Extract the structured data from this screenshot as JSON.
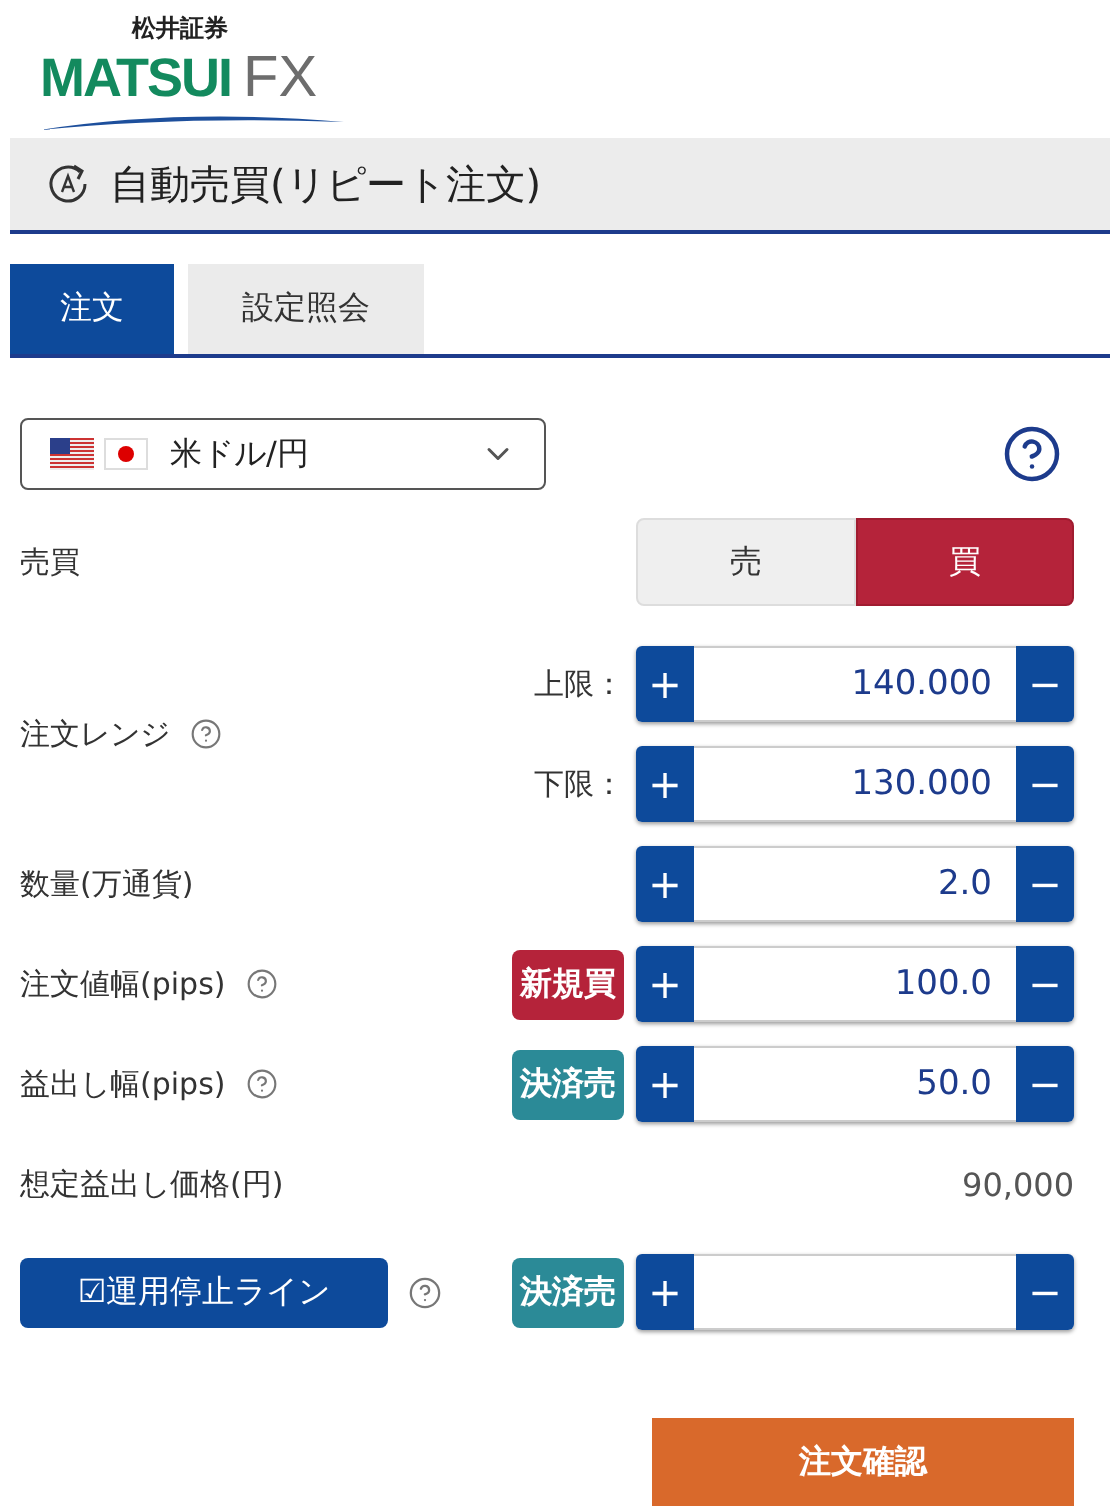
{
  "logo": {
    "caption": "松井証券",
    "brand": "MATSUI",
    "suffix": "FX"
  },
  "title": "自動売買(リピート注文)",
  "tabs": [
    {
      "label": "注文",
      "selected": true
    },
    {
      "label": "設定照会",
      "selected": false
    }
  ],
  "pair_select": {
    "value": "米ドル/円"
  },
  "side": {
    "label": "売買",
    "options": [
      {
        "label": "売",
        "selected": false
      },
      {
        "label": "買",
        "selected": true
      }
    ]
  },
  "range": {
    "label": "注文レンジ",
    "help": true,
    "bounds": [
      {
        "label": "上限：",
        "plus": "+",
        "value": "140.000",
        "minus": "−"
      },
      {
        "label": "下限：",
        "plus": "+",
        "value": "130.000",
        "minus": "−"
      }
    ]
  },
  "rows": [
    {
      "kind": "stepper",
      "label": "数量(万通貨)",
      "help": false,
      "plus": "+",
      "value": "2.0",
      "minus": "−"
    },
    {
      "kind": "stepper",
      "label": "注文値幅(pips)",
      "help": true,
      "tag": {
        "label": "新規買",
        "color": "#b5233a"
      },
      "plus": "+",
      "value": "100.0",
      "minus": "−"
    },
    {
      "kind": "stepper",
      "label": "益出し幅(pips)",
      "help": true,
      "tag": {
        "label": "決済売",
        "color": "#2b8a97"
      },
      "plus": "+",
      "value": "50.0",
      "minus": "−"
    },
    {
      "kind": "readout",
      "label": "想定益出し価格(円)",
      "value": "90,000"
    },
    {
      "kind": "toggle",
      "label": "☑運用停止ライン",
      "help": true,
      "tag": {
        "label": "決済売",
        "color": "#2b8a97"
      },
      "plus": "+",
      "value": "",
      "minus": "−"
    }
  ],
  "confirm_button": "注文確認"
}
